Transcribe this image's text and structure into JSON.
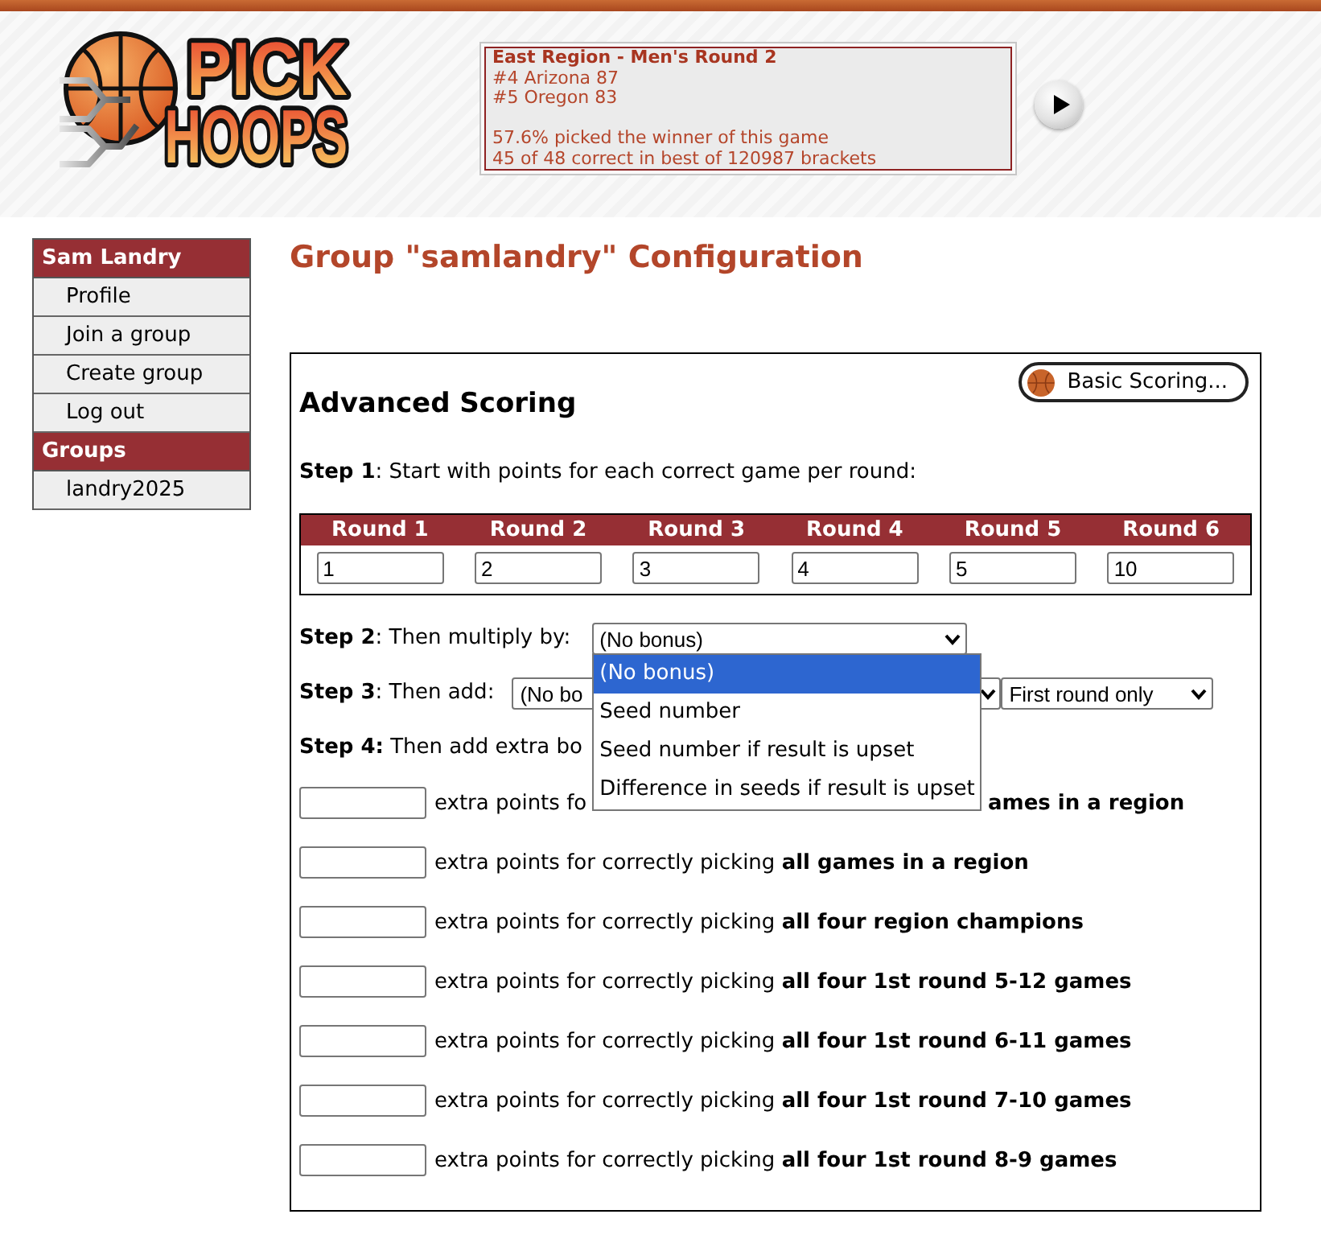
{
  "header": {
    "logo": {
      "lines": [
        "PICK",
        "HOOPS"
      ]
    },
    "scoreboard": {
      "title": "East Region - Men's Round 2",
      "teams": [
        "#4 Arizona 87",
        "#5 Oregon 83"
      ],
      "stats": [
        "57.6% picked the winner of this game",
        "45 of 48 correct in best of 120987 brackets"
      ]
    }
  },
  "sidebar": {
    "sections": [
      {
        "title": "Sam Landry",
        "items": [
          "Profile",
          "Join a group",
          "Create group",
          "Log out"
        ]
      },
      {
        "title": "Groups",
        "items": [
          "landry2025"
        ]
      }
    ]
  },
  "page_title": "Group \"samlandry\" Configuration",
  "scoring": {
    "title": "Advanced Scoring",
    "mode_button": "Basic Scoring...",
    "step_1": {
      "text": "**Step 1**: Start with points for each correct game per round:",
      "rounds": [
        {
          "label": "Round 1",
          "value": "1"
        },
        {
          "label": "Round 2",
          "value": "2"
        },
        {
          "label": "Round 3",
          "value": "3"
        },
        {
          "label": "Round 4",
          "value": "4"
        },
        {
          "label": "Round 5",
          "value": "5"
        },
        {
          "label": "Round 6",
          "value": "10"
        }
      ]
    },
    "step_2": {
      "text": "**Step 2**: Then multiply by:",
      "select": {
        "value": "(No bonus)",
        "expanded": true,
        "options": [
          {
            "label": "(No bonus)",
            "selected": true
          },
          {
            "label": "Seed number",
            "selected": false
          },
          {
            "label": "Seed number if result is upset",
            "selected": false
          },
          {
            "label": "Difference in seeds if result is upset",
            "selected": false
          }
        ]
      }
    },
    "step_3": {
      "text": "**Step 3**: Then add:",
      "selects": [
        {
          "value": "(No bo"
        },
        {
          "value": "First round only"
        }
      ]
    },
    "step_4": {
      "text": "**Step 4:** Then add extra bo",
      "bonuses": [
        {
          "kind": "partly_covered",
          "text": "extra points fo",
          "text_end": "ames in a region"
        },
        {
          "kind": "full",
          "text": "extra points for correctly picking **all games in a region**"
        },
        {
          "kind": "full",
          "text": "extra points for correctly picking **all four region champions**"
        },
        {
          "kind": "full",
          "text": "extra points for correctly picking **all four 1st round 5-12 games**"
        },
        {
          "kind": "full",
          "text": "extra points for correctly picking **all four 1st round 6-11 games**"
        },
        {
          "kind": "full",
          "text": "extra points for correctly picking **all four 1st round 7-10 games**"
        },
        {
          "kind": "full",
          "text": "extra points for correctly picking **all four 1st round 8-9 games**"
        }
      ]
    }
  }
}
